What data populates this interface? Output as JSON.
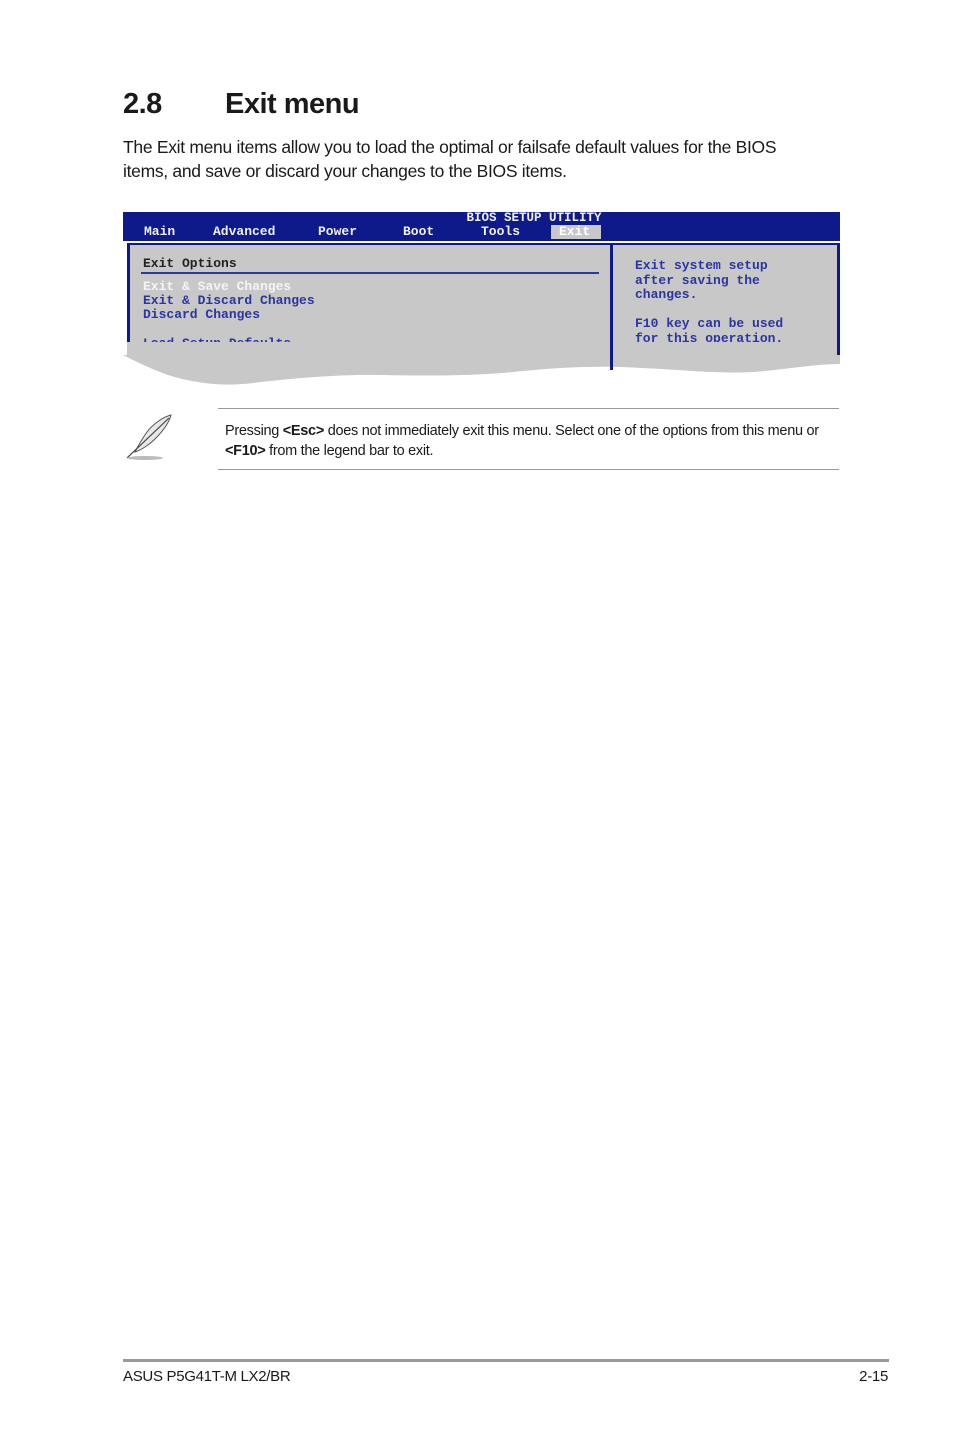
{
  "section": {
    "number": "2.8",
    "title": "Exit menu"
  },
  "intro": "The Exit menu items allow you to load the optimal or failsafe default values for the BIOS items, and save or discard your changes to the BIOS items.",
  "bios": {
    "title": "BIOS SETUP UTILITY",
    "tabs": [
      {
        "label": "Main",
        "active": false
      },
      {
        "label": "Advanced",
        "active": false
      },
      {
        "label": "Power",
        "active": false
      },
      {
        "label": "Boot",
        "active": false
      },
      {
        "label": "Tools",
        "active": false
      },
      {
        "label": "Exit",
        "active": true
      }
    ],
    "left_title": "Exit Options",
    "options": [
      {
        "label": "Exit & Save Changes",
        "selected": true
      },
      {
        "label": "Exit & Discard Changes",
        "selected": false
      },
      {
        "label": "Discard Changes",
        "selected": false
      },
      {
        "label": "Load Setup Defaults",
        "selected": false
      }
    ],
    "help_lines": [
      "Exit system setup",
      "after saving the",
      "changes.",
      "",
      "F10 key can be used",
      "for this operation."
    ],
    "colors": {
      "bar": "#0e1a8a",
      "panel": "#c8c8c8",
      "text": "#2a35a0"
    }
  },
  "note": {
    "icon": "feather-pen-icon",
    "prefix": "Pressing ",
    "key1": "<Esc>",
    "middle": " does not immediately exit this menu. Select one of the options from this menu or ",
    "key2": "<F10>",
    "suffix": " from the legend bar to exit."
  },
  "footer": {
    "product": "ASUS P5G41T-M LX2/BR",
    "page": "2-15"
  }
}
